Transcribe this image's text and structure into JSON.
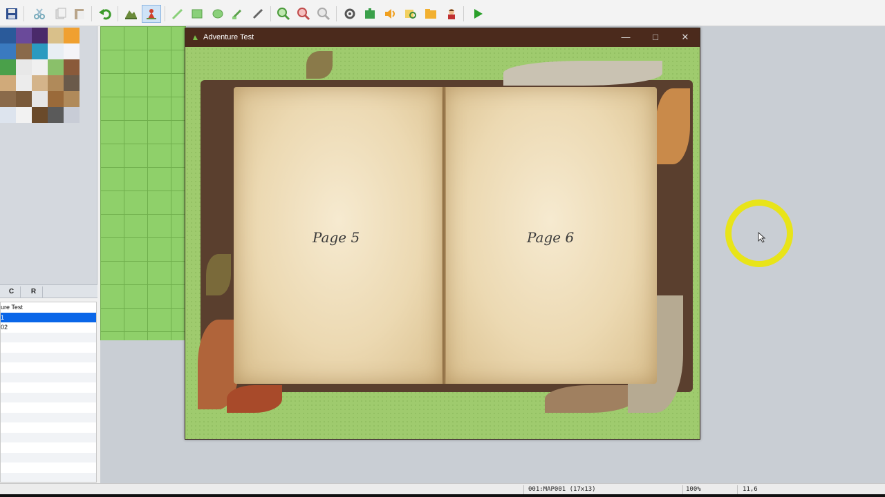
{
  "toolbar": {
    "icons": [
      "save-icon",
      "cut-icon",
      "copy-icon",
      "paste-icon",
      "undo-icon",
      "map-layer-icon",
      "event-layer-icon",
      "pencil-icon",
      "rectangle-icon",
      "ellipse-icon",
      "fill-icon",
      "shadow-pen-icon",
      "zoom-in-icon",
      "zoom-out-icon",
      "zoom-actual-icon",
      "database-icon",
      "plugin-icon",
      "sound-icon",
      "event-searcher-icon",
      "resource-manager-icon",
      "character-generator-icon",
      "playtest-icon"
    ],
    "active": "event-layer-icon"
  },
  "tileset_tabs": [
    "C",
    "R"
  ],
  "map_list": {
    "items": [
      "ure Test",
      "1",
      "02",
      "",
      "",
      "",
      "",
      "",
      "",
      "",
      "",
      "",
      "",
      "",
      "",
      "",
      "",
      ""
    ],
    "selected_index": 1
  },
  "game_window": {
    "title": "Adventure Test",
    "minimize": "—",
    "maximize": "□",
    "close": "✕"
  },
  "book": {
    "left_page": "Page 5",
    "right_page": "Page 6"
  },
  "status": {
    "map": "001:MAP001 (17x13)",
    "zoom": "100%",
    "coords": "11,6"
  },
  "colors": {
    "titlebar": "#4b2a1c",
    "selection": "#0a66e8",
    "cursor_ring": "#e8e419",
    "grass": "#9fcb6e"
  }
}
